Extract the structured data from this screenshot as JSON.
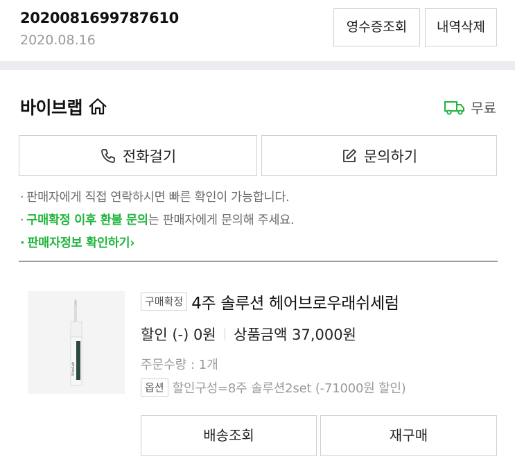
{
  "order": {
    "number": "2020081699787610",
    "date": "2020.08.16",
    "receipt_label": "영수증조회",
    "delete_label": "내역삭제"
  },
  "store": {
    "name": "바이브랩",
    "shipping": "무료",
    "call_label": "전화걸기",
    "inquiry_label": "문의하기",
    "notes": {
      "line1": "판매자에게 직접 연락하시면 빠른 확인이 가능합니다.",
      "line2_highlight": "구매확정 이후 환불 문의",
      "line2_rest": "는 판매자에게 문의해 주세요.",
      "line3_link": "판매자정보 확인하기",
      "bullet": "·",
      "link_chevron": "›"
    }
  },
  "product": {
    "status_badge": "구매확정",
    "title": "4주 솔루션 헤어브로우래쉬세럼",
    "discount": "할인 (-) 0원",
    "price": "상품금액 37,000원",
    "quantity": "주문수량 : 1개",
    "option_badge": "옵션",
    "option_text": "할인구성=8주 솔루션2set (-71000원 할인)",
    "track_label": "배송조회",
    "rebuy_label": "재구매",
    "image_text": "VibeLab"
  },
  "colors": {
    "accent_green": "#1fb53c",
    "divider_band": "#ebedf0"
  },
  "icons": {
    "store": "home-icon",
    "shipping": "truck-icon",
    "call": "phone-icon",
    "inquiry": "edit-icon"
  }
}
